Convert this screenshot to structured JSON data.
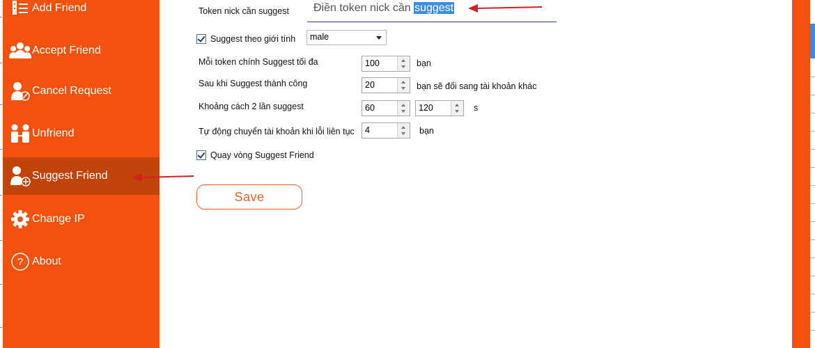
{
  "sidebar": {
    "items": [
      {
        "label": "Add Friend",
        "icon": "add-friend-icon"
      },
      {
        "label": "Accept Friend",
        "icon": "accept-friend-icon"
      },
      {
        "label": "Cancel Request",
        "icon": "cancel-request-icon"
      },
      {
        "label": "Unfriend",
        "icon": "unfriend-icon"
      },
      {
        "label": "Suggest Friend",
        "icon": "suggest-friend-icon",
        "active": true
      },
      {
        "label": "Change IP",
        "icon": "gear-icon"
      },
      {
        "label": "About",
        "icon": "question-icon"
      }
    ]
  },
  "form": {
    "token_label": "Token nick cần suggest",
    "token_placeholder_plain": "Điền token nick cần ",
    "token_placeholder_selected": "suggest",
    "gender_checkbox_label": "Suggest theo giới tính",
    "gender_value": "male",
    "max_suggest_label": "Mỗi token chính Suggest tối đa",
    "max_suggest_value": "100",
    "max_suggest_unit": "bạn",
    "after_success_label": "Sau khi Suggest thành công",
    "after_success_value": "20",
    "after_success_unit": "bạn sẽ đổi sang tài khoản khác",
    "interval_label": "Khoảng cách 2 lần suggest",
    "interval_min": "60",
    "interval_max": "120",
    "interval_unit": "s",
    "auto_switch_label": "Tự động chuyển tài khoản khi lỗi liên tục",
    "auto_switch_value": "4",
    "auto_switch_unit": "bạn",
    "loop_checkbox_label": "Quay vòng Suggest Friend",
    "save_label": "Save"
  },
  "colors": {
    "sidebar": "#f2520e",
    "sidebar_active": "#c2440a",
    "annotation_arrow": "#d42020"
  }
}
